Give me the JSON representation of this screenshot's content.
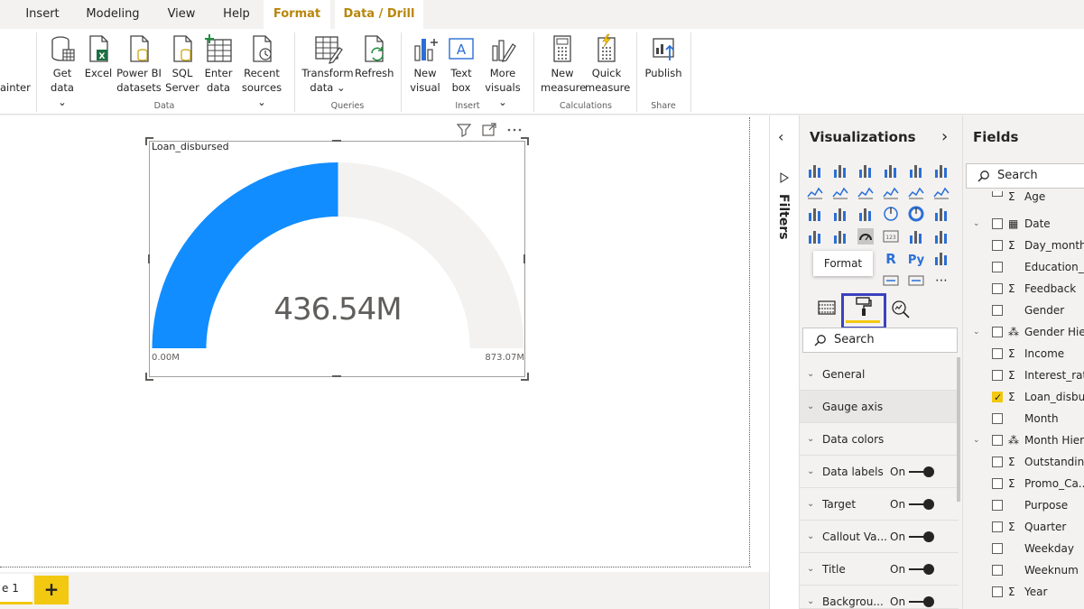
{
  "menubar": {
    "items": [
      "Insert",
      "Modeling",
      "View",
      "Help",
      "Format",
      "Data / Drill"
    ]
  },
  "ribbon": {
    "partial_left": "ainter",
    "buttons": [
      {
        "line1": "Get",
        "line2": "data ⌄"
      },
      {
        "line1": "Excel",
        "line2": ""
      },
      {
        "line1": "Power BI",
        "line2": "datasets"
      },
      {
        "line1": "SQL",
        "line2": "Server"
      },
      {
        "line1": "Enter",
        "line2": "data"
      },
      {
        "line1": "Recent",
        "line2": "sources ⌄"
      },
      {
        "line1": "Transform",
        "line2": "data ⌄"
      },
      {
        "line1": "Refresh",
        "line2": ""
      },
      {
        "line1": "New",
        "line2": "visual"
      },
      {
        "line1": "Text",
        "line2": "box"
      },
      {
        "line1": "More",
        "line2": "visuals ⌄"
      },
      {
        "line1": "New",
        "line2": "measure"
      },
      {
        "line1": "Quick",
        "line2": "measure"
      },
      {
        "line1": "Publish",
        "line2": ""
      }
    ],
    "groups": [
      "Data",
      "Queries",
      "Insert",
      "Calculations",
      "Share"
    ]
  },
  "visual": {
    "title": "Loan_disbursed",
    "value_label": "436.54M",
    "min_label": "0.00M",
    "max_label": "873.07M",
    "fill_fraction": 0.5,
    "fill_color": "#118dff",
    "track_color": "#f3f2f1"
  },
  "pages": {
    "tab_label": "e 1",
    "add_label": "+"
  },
  "filters": {
    "label": "Filters"
  },
  "visualizations": {
    "title": "Visualizations",
    "tooltip": "Format",
    "search_placeholder": "Search",
    "sections": [
      {
        "label": "General",
        "state": ""
      },
      {
        "label": "Gauge axis",
        "state": ""
      },
      {
        "label": "Data colors",
        "state": ""
      },
      {
        "label": "Data labels",
        "state": "On"
      },
      {
        "label": "Target",
        "state": "On"
      },
      {
        "label": "Callout Va...",
        "state": "On"
      },
      {
        "label": "Title",
        "state": "On"
      },
      {
        "label": "Backgrou...",
        "state": "On"
      }
    ]
  },
  "fields": {
    "title": "Fields",
    "search_placeholder": "Search",
    "items": [
      {
        "name": "Age",
        "type": "Σ",
        "checked": false,
        "expand": ""
      },
      {
        "name": "Date",
        "type": "▦",
        "checked": false,
        "expand": "⌄"
      },
      {
        "name": "Day_month",
        "type": "Σ",
        "checked": false,
        "expand": ""
      },
      {
        "name": "Education_l...",
        "type": "",
        "checked": false,
        "expand": ""
      },
      {
        "name": "Feedback",
        "type": "Σ",
        "checked": false,
        "expand": ""
      },
      {
        "name": "Gender",
        "type": "",
        "checked": false,
        "expand": ""
      },
      {
        "name": "Gender Hie...",
        "type": "⁂",
        "checked": false,
        "expand": "⌄"
      },
      {
        "name": "Income",
        "type": "Σ",
        "checked": false,
        "expand": ""
      },
      {
        "name": "Interest_rate",
        "type": "Σ",
        "checked": false,
        "expand": ""
      },
      {
        "name": "Loan_disbu...",
        "type": "Σ",
        "checked": true,
        "expand": ""
      },
      {
        "name": "Month",
        "type": "",
        "checked": false,
        "expand": ""
      },
      {
        "name": "Month Hier...",
        "type": "⁂",
        "checked": false,
        "expand": "⌄"
      },
      {
        "name": "Outstandin...",
        "type": "Σ",
        "checked": false,
        "expand": ""
      },
      {
        "name": "Promo_Ca...",
        "type": "Σ",
        "checked": false,
        "expand": ""
      },
      {
        "name": "Purpose",
        "type": "",
        "checked": false,
        "expand": ""
      },
      {
        "name": "Quarter",
        "type": "Σ",
        "checked": false,
        "expand": ""
      },
      {
        "name": "Weekday",
        "type": "",
        "checked": false,
        "expand": ""
      },
      {
        "name": "Weeknum",
        "type": "",
        "checked": false,
        "expand": ""
      },
      {
        "name": "Year",
        "type": "Σ",
        "checked": false,
        "expand": ""
      }
    ]
  }
}
